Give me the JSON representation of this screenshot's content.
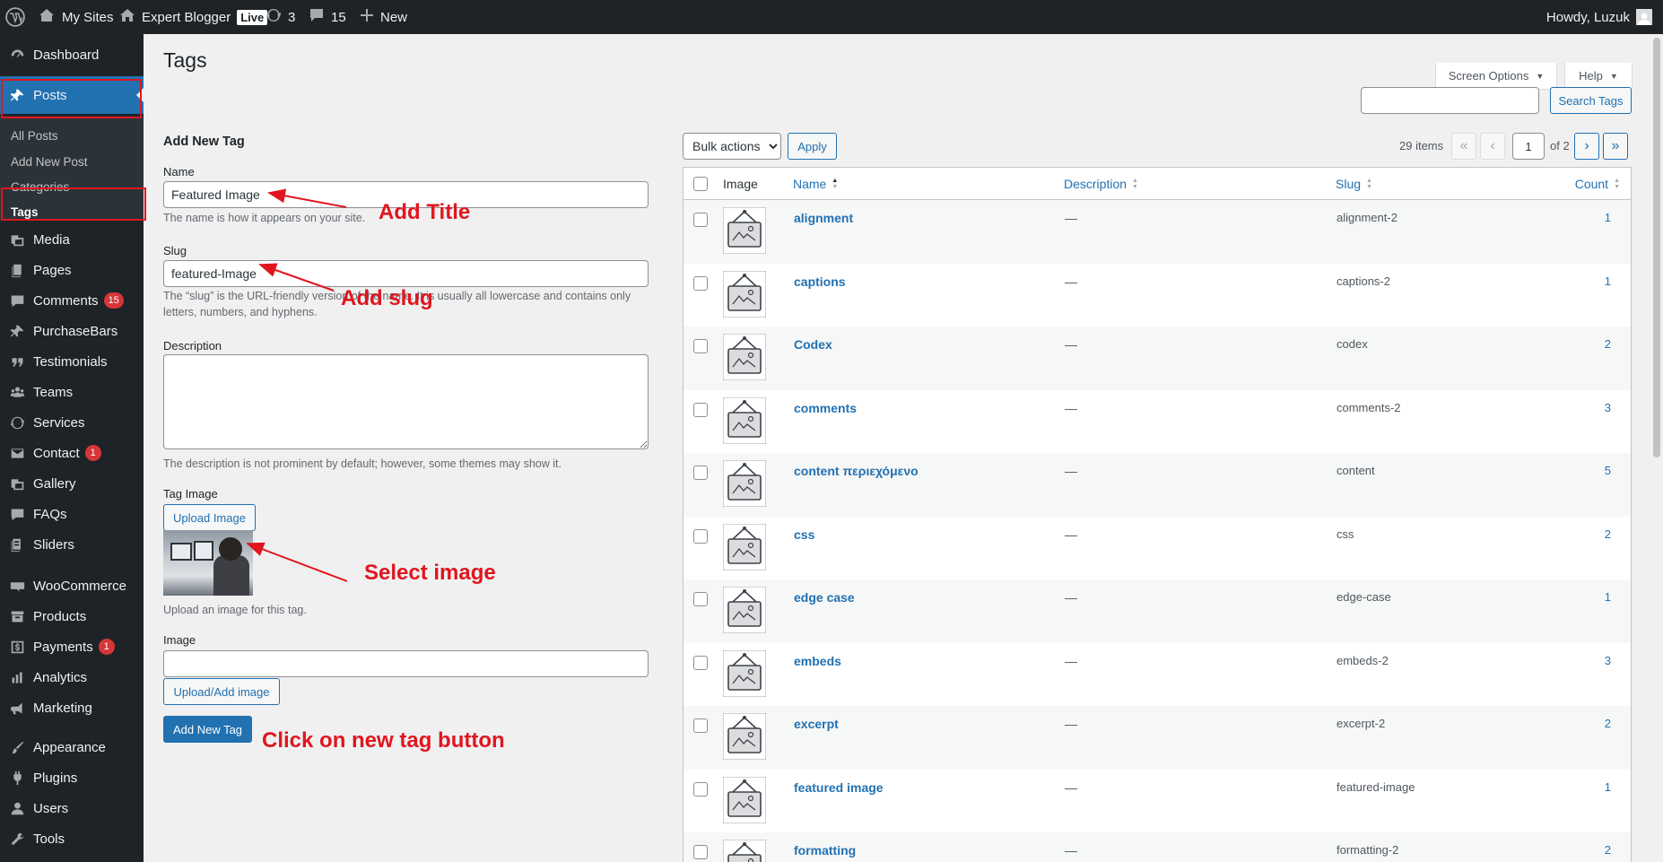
{
  "adminbar": {
    "my_sites": "My Sites",
    "site_name": "Expert Blogger",
    "live_badge": "Live",
    "updates_count": "3",
    "comments_count": "15",
    "new_label": "New",
    "howdy": "Howdy, Luzuk"
  },
  "sidebar": {
    "items": [
      {
        "label": "Dashboard",
        "icon": "dashboard-icon"
      },
      {
        "label": "Posts",
        "icon": "pin-icon"
      },
      {
        "label": "Media",
        "icon": "media-icon"
      },
      {
        "label": "Pages",
        "icon": "pages-icon"
      },
      {
        "label": "Comments",
        "icon": "comment-icon",
        "badge": "15"
      },
      {
        "label": "PurchaseBars",
        "icon": "pin-icon"
      },
      {
        "label": "Testimonials",
        "icon": "quote-icon"
      },
      {
        "label": "Teams",
        "icon": "groups-icon"
      },
      {
        "label": "Services",
        "icon": "services-icon"
      },
      {
        "label": "Contact",
        "icon": "email-icon",
        "badge": "1"
      },
      {
        "label": "Gallery",
        "icon": "gallery-icon"
      },
      {
        "label": "FAQs",
        "icon": "faq-icon"
      },
      {
        "label": "Sliders",
        "icon": "sliders-icon"
      },
      {
        "label": "WooCommerce",
        "icon": "woo-icon"
      },
      {
        "label": "Products",
        "icon": "archive-icon"
      },
      {
        "label": "Payments",
        "icon": "dollar-icon",
        "badge": "1"
      },
      {
        "label": "Analytics",
        "icon": "chart-icon"
      },
      {
        "label": "Marketing",
        "icon": "megaphone-icon"
      },
      {
        "label": "Appearance",
        "icon": "brush-icon"
      },
      {
        "label": "Plugins",
        "icon": "plugin-icon"
      },
      {
        "label": "Users",
        "icon": "user-icon"
      },
      {
        "label": "Tools",
        "icon": "wrench-icon"
      }
    ],
    "submenu": [
      "All Posts",
      "Add New Post",
      "Categories",
      "Tags"
    ]
  },
  "header": {
    "title": "Tags",
    "screen_options": "Screen Options",
    "help": "Help",
    "search_button": "Search Tags",
    "search_value": ""
  },
  "form": {
    "heading": "Add New Tag",
    "name_label": "Name",
    "name_value": "Featured Image",
    "name_help": "The name is how it appears on your site.",
    "slug_label": "Slug",
    "slug_value": "featured-Image",
    "slug_help": "The “slug” is the URL-friendly version of the name. It is usually all lowercase and contains only letters, numbers, and hyphens.",
    "description_label": "Description",
    "description_value": "",
    "description_help": "The description is not prominent by default; however, some themes may show it.",
    "tag_image_label": "Tag Image",
    "upload_button": "Upload Image",
    "upload_help": "Upload an image for this tag.",
    "image_label": "Image",
    "image_value": "",
    "upload_add_button": "Upload/Add image",
    "submit_button": "Add New Tag"
  },
  "annotations": {
    "title": "Add Title",
    "slug": "Add slug",
    "image": "Select image",
    "button": "Click on new tag button"
  },
  "list": {
    "bulk_selected": "Bulk actions",
    "apply": "Apply",
    "items_count": "29 items",
    "current_page": "1",
    "total_pages": "of 2",
    "columns": {
      "image": "Image",
      "name": "Name",
      "description": "Description",
      "slug": "Slug",
      "count": "Count"
    },
    "rows": [
      {
        "name": "alignment",
        "description": "—",
        "slug": "alignment-2",
        "count": "1"
      },
      {
        "name": "captions",
        "description": "—",
        "slug": "captions-2",
        "count": "1"
      },
      {
        "name": "Codex",
        "description": "—",
        "slug": "codex",
        "count": "2"
      },
      {
        "name": "comments",
        "description": "—",
        "slug": "comments-2",
        "count": "3"
      },
      {
        "name": "content περιεχόμενο",
        "description": "—",
        "slug": "content",
        "count": "5"
      },
      {
        "name": "css",
        "description": "—",
        "slug": "css",
        "count": "2"
      },
      {
        "name": "edge case",
        "description": "—",
        "slug": "edge-case",
        "count": "1"
      },
      {
        "name": "embeds",
        "description": "—",
        "slug": "embeds-2",
        "count": "3"
      },
      {
        "name": "excerpt",
        "description": "—",
        "slug": "excerpt-2",
        "count": "2"
      },
      {
        "name": "featured image",
        "description": "—",
        "slug": "featured-image",
        "count": "1"
      },
      {
        "name": "formatting",
        "description": "—",
        "slug": "formatting-2",
        "count": "2"
      }
    ]
  }
}
